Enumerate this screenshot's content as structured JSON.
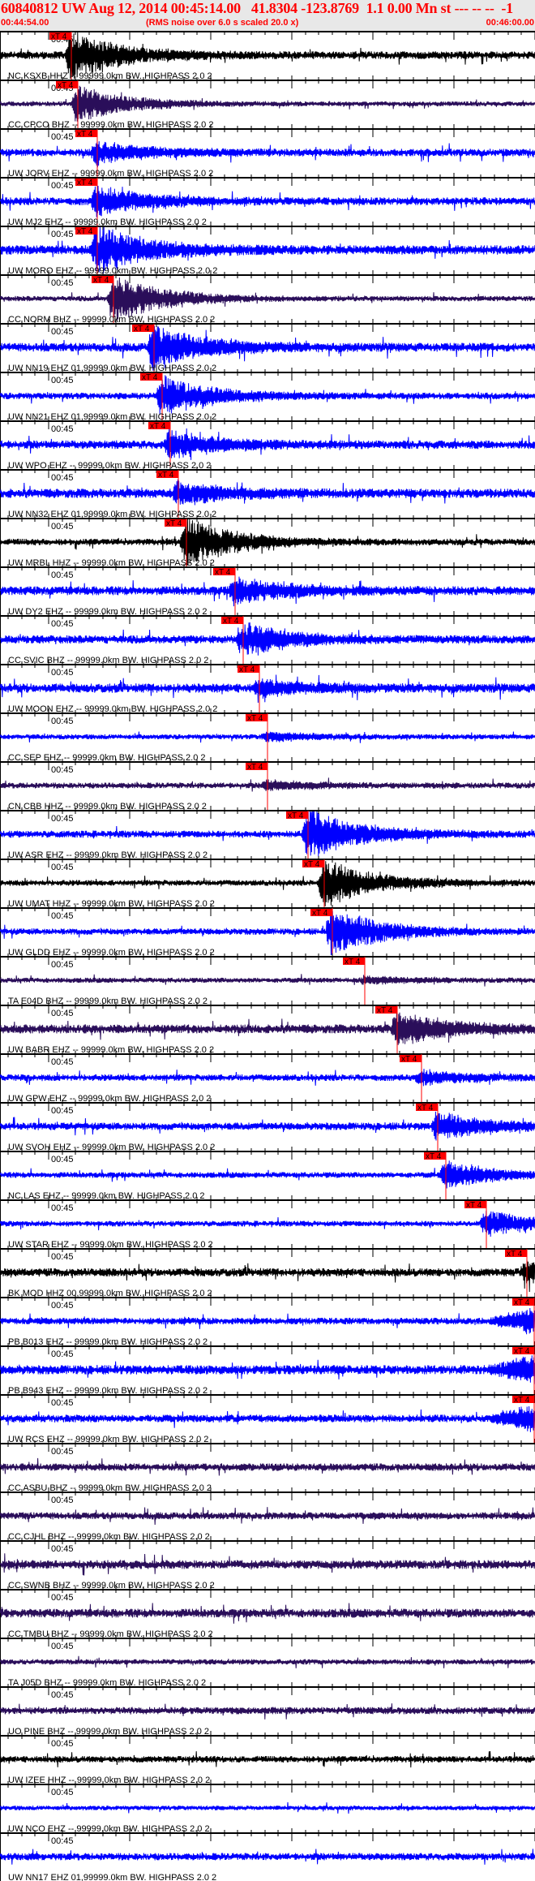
{
  "header": {
    "title": "60840812 UW Aug 12, 2014 00:45:14.00   41.8304 -123.8769  1.1 0.00 Mn st --- -- --  -1",
    "start_time": "00:44:54.00",
    "note": "(RMS noise over 6.0 s scaled 20.0 x)",
    "end_time": "00:46:00.00"
  },
  "axis": {
    "minute_label": "00:45",
    "start": "00:44:54.00",
    "end": "00:46:00.00"
  },
  "pick_label": "xT 4",
  "colors": {
    "blue": "#0000ff",
    "black": "#000000",
    "purple": "#2a0e5a",
    "pick": "#ff0000",
    "header_bg": "#e8e8e8"
  },
  "traces": [
    {
      "label": "NC KSXB HHZ -- 99999.0km BW. HIGHPASS 2.0 2",
      "color": "black",
      "pick": "00:45:02.8"
    },
    {
      "label": "CC CPCO BHZ -- 99999.0km BW. HIGHPASS 2.0 2",
      "color": "purple",
      "pick": "00:45:03.6"
    },
    {
      "label": "UW JORV EHZ -- 99999.0km BW. HIGHPASS 2.0 2",
      "color": "blue",
      "pick": "00:45:06.0"
    },
    {
      "label": "UW MJ2 EHZ -- 99999.0km BW. HIGHPASS 2.0 2",
      "color": "blue",
      "pick": "00:45:06.0"
    },
    {
      "label": "UW MORO EHZ -- 99999.0km BW. HIGHPASS 2.0 2",
      "color": "blue",
      "pick": "00:45:06.0"
    },
    {
      "label": "CC NORM BHZ -- 99999.0km BW. HIGHPASS 2.0 2",
      "color": "purple",
      "pick": "00:45:08.0"
    },
    {
      "label": "UW NN19 EHZ 01,99999.0km BW. HIGHPASS 2.0 2",
      "color": "blue",
      "pick": "00:45:13.0"
    },
    {
      "label": "UW NN21 EHZ 01,99999.0km BW. HIGHPASS 2.0 2",
      "color": "blue",
      "pick": "00:45:14.0"
    },
    {
      "label": "UW WPO EHZ -- 99999.0km BW. HIGHPASS 2.0 2",
      "color": "blue",
      "pick": "00:45:15.0"
    },
    {
      "label": "UW NN32 EHZ 01,99999.0km BW. HIGHPASS 2.0 2",
      "color": "blue",
      "pick": "00:45:16.0"
    },
    {
      "label": "UW MRBL HHZ -- 99999.0km BW. HIGHPASS 2.0 2",
      "color": "black",
      "pick": "00:45:17.0"
    },
    {
      "label": "UW DY2 EHZ -- 99999.0km BW. HIGHPASS 2.0 2",
      "color": "blue",
      "pick": "00:45:23.0"
    },
    {
      "label": "CC SVIC BHZ -- 99999.0km BW. HIGHPASS 2.0 2",
      "color": "blue",
      "pick": "00:45:24.0"
    },
    {
      "label": "UW MOON EHZ -- 99999.0km BW. HIGHPASS 2.0 2",
      "color": "blue",
      "pick": "00:45:26.0"
    },
    {
      "label": "CC SEP EHZ -- 99999.0km BW. HIGHPASS 2.0 2",
      "color": "blue",
      "pick": "00:45:27.0"
    },
    {
      "label": "CN CBB HHZ -- 99999.0km BW. HIGHPASS 2.0 2",
      "color": "purple",
      "pick": "00:45:27.0"
    },
    {
      "label": "UW ASR EHZ -- 99999.0km BW. HIGHPASS 2.0 2",
      "color": "blue",
      "pick": "00:45:32.0"
    },
    {
      "label": "UW UMAT HHZ -- 99999.0km BW. HIGHPASS 2.0 2",
      "color": "black",
      "pick": "00:45:34.0"
    },
    {
      "label": "UW GLDD EHZ -- 99999.0km BW. HIGHPASS 2.0 2",
      "color": "blue",
      "pick": "00:45:35.0"
    },
    {
      "label": "TA E04D BHZ -- 99999.0km BW. HIGHPASS 2.0 2",
      "color": "purple",
      "pick": "00:45:39.0"
    },
    {
      "label": "UW BABR EHZ -- 99999.0km BW. HIGHPASS 2.0 2",
      "color": "purple",
      "pick": "00:45:43.0"
    },
    {
      "label": "UW GPW EHZ -- 99999.0km BW. HIGHPASS 2.0 2",
      "color": "blue",
      "pick": "00:45:46.0"
    },
    {
      "label": "UW SVOH EHZ -- 99999.0km BW. HIGHPASS 2.0 2",
      "color": "blue",
      "pick": "00:45:48.0"
    },
    {
      "label": "NC LAS EHZ -- 99999.0km BW. HIGHPASS 2.0 2",
      "color": "blue",
      "pick": "00:45:49.0"
    },
    {
      "label": "UW STAR EHZ -- 99999.0km BW. HIGHPASS 2.0 2",
      "color": "blue",
      "pick": "00:45:54.0"
    },
    {
      "label": "BK MOD HHZ 00,99999.0km BW. HIGHPASS 2.0 2",
      "color": "black",
      "pick": "00:45:59.0"
    },
    {
      "label": "PB B013 EHZ -- 99999.0km BW. HIGHPASS 2.0 2",
      "color": "blue",
      "pick": "00:46:00.0"
    },
    {
      "label": "PB B943 EHZ -- 99999.0km BW. HIGHPASS 2.0 2",
      "color": "blue",
      "pick": "00:46:00.0"
    },
    {
      "label": "UW RCS EHZ -- 99999.0km BW. HIGHPASS 2.0 2",
      "color": "blue",
      "pick": "00:46:00.0"
    },
    {
      "label": "CC ASBU BHZ -- 99999.0km BW. HIGHPASS 2.0 2",
      "color": "purple",
      "pick": null
    },
    {
      "label": "CC CJHL BHZ -- 99999.0km BW. HIGHPASS 2.0 2",
      "color": "purple",
      "pick": null
    },
    {
      "label": "CC SWNB BHZ -- 99999.0km BW. HIGHPASS 2.0 2",
      "color": "purple",
      "pick": null
    },
    {
      "label": "CC TMBU BHZ -- 99999.0km BW. HIGHPASS 2.0 2",
      "color": "purple",
      "pick": null
    },
    {
      "label": "TA J05D BHZ -- 99999.0km BW. HIGHPASS 2.0 2",
      "color": "purple",
      "pick": null
    },
    {
      "label": "UO PINE BHZ -- 99999.0km BW. HIGHPASS 2.0 2",
      "color": "purple",
      "pick": null
    },
    {
      "label": "UW IZEE HHZ -- 99999.0km BW. HIGHPASS 2.0 2",
      "color": "black",
      "pick": null
    },
    {
      "label": "UW NCO EHZ -- 99999.0km BW. HIGHPASS 2.0 2",
      "color": "blue",
      "pick": null
    },
    {
      "label": "UW NN17 EHZ 01,99999.0km BW. HIGHPASS 2.0 2",
      "color": "blue",
      "pick": null
    }
  ]
}
